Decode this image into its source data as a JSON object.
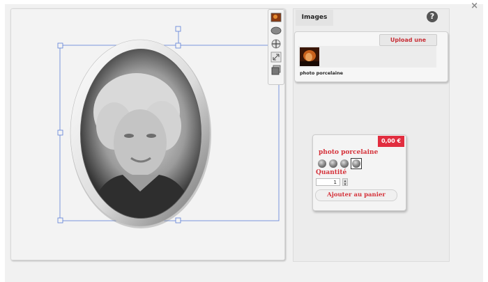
{
  "window": {
    "close_glyph": "×"
  },
  "tabs": [
    {
      "label": "Images"
    }
  ],
  "help": {
    "glyph": "?"
  },
  "images_panel": {
    "upload_label": "Upload une image",
    "items": [
      {
        "label": "photo porcelaine"
      }
    ]
  },
  "cart": {
    "price": "0,00 €",
    "product_name": "photo porcelaine",
    "quantity_label": "Quantité",
    "quantity_value": "1",
    "add_to_cart_label": "Ajouter au panier",
    "swatches": [
      "finish-1",
      "finish-2",
      "finish-3",
      "finish-4"
    ]
  },
  "toolbar": {
    "tools": [
      "image-icon",
      "oval-shape-icon",
      "move-icon",
      "resize-icon",
      "layers-icon"
    ]
  },
  "colors": {
    "accent": "#d5323a",
    "price_bg": "#e12d3f",
    "selection": "#5b7fd8"
  }
}
